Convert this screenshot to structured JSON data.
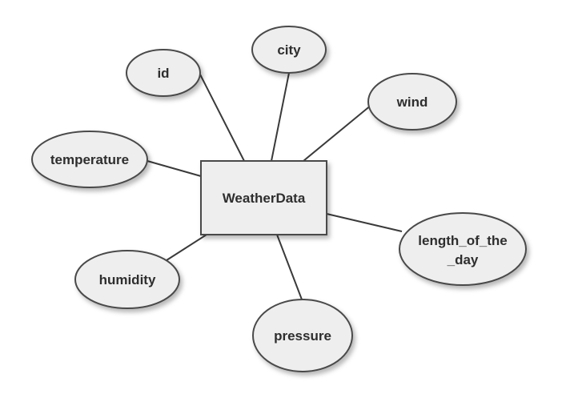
{
  "diagram": {
    "entity": {
      "label": "WeatherData"
    },
    "attributes": [
      {
        "id": "id",
        "lines": [
          "id"
        ]
      },
      {
        "id": "city",
        "lines": [
          "city"
        ]
      },
      {
        "id": "wind",
        "lines": [
          "wind"
        ]
      },
      {
        "id": "temperature",
        "lines": [
          "temperature"
        ]
      },
      {
        "id": "length_of_the_day",
        "lines": [
          "length_of_the",
          "_day"
        ]
      },
      {
        "id": "humidity",
        "lines": [
          "humidity"
        ]
      },
      {
        "id": "pressure",
        "lines": [
          "pressure"
        ]
      }
    ],
    "colors": {
      "node_fill": "#eeeeee",
      "node_stroke": "#4a4a4a",
      "line": "#3a3a3a",
      "text": "#2e2e2e"
    }
  }
}
